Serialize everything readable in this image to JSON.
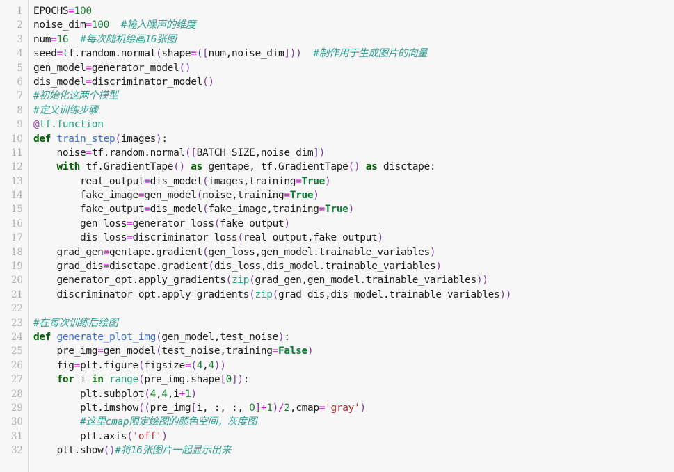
{
  "editor": {
    "background_color": "#f7f7f7",
    "gutter_color": "#f7f7f7",
    "line_number_color": "#b0b0b0",
    "language": "Python",
    "first_line_number": 1,
    "last_line_number": 32,
    "total_lines": 32
  },
  "palette": {
    "keyword": "#006400",
    "constant": "#0a7a33",
    "number": "#1a7f37",
    "operator": "#cc00cc",
    "bracket": "#7a3fa0",
    "comment": "#2e9e8f",
    "function": "#3b6fd4",
    "builtin": "#1f9e7a",
    "decorator": "#a040c0",
    "string": "#b03030",
    "text": "#202020"
  },
  "line_numbers": [
    "1",
    "2",
    "3",
    "4",
    "5",
    "6",
    "7",
    "8",
    "9",
    "10",
    "11",
    "12",
    "13",
    "14",
    "15",
    "16",
    "17",
    "18",
    "19",
    "20",
    "21",
    "22",
    "23",
    "24",
    "25",
    "26",
    "27",
    "28",
    "29",
    "30",
    "31",
    "32"
  ],
  "code_lines": [
    {
      "number": "1",
      "text": "EPOCHS=100",
      "tokens": [
        {
          "t": "EPOCHS",
          "c": "t-plain"
        },
        {
          "t": "=",
          "c": "t-op"
        },
        {
          "t": "100",
          "c": "t-num"
        }
      ]
    },
    {
      "number": "2",
      "text": "noise_dim=100  #输入噪声的维度",
      "tokens": [
        {
          "t": "noise_dim",
          "c": "t-plain"
        },
        {
          "t": "=",
          "c": "t-op"
        },
        {
          "t": "100",
          "c": "t-num"
        },
        {
          "t": "  ",
          "c": "t-plain"
        },
        {
          "t": "#输入噪声的维度",
          "c": "t-comment"
        }
      ]
    },
    {
      "number": "3",
      "text": "num=16  #每次随机绘画16张图",
      "tokens": [
        {
          "t": "num",
          "c": "t-plain"
        },
        {
          "t": "=",
          "c": "t-op"
        },
        {
          "t": "16",
          "c": "t-num"
        },
        {
          "t": "  ",
          "c": "t-plain"
        },
        {
          "t": "#每次随机绘画16张图",
          "c": "t-comment"
        }
      ]
    },
    {
      "number": "4",
      "text": "seed=tf.random.normal(shape=([num,noise_dim]))  #制作用于生成图片的向量",
      "tokens": [
        {
          "t": "seed",
          "c": "t-plain"
        },
        {
          "t": "=",
          "c": "t-op"
        },
        {
          "t": "tf.random.normal",
          "c": "t-plain"
        },
        {
          "t": "(",
          "c": "t-punct"
        },
        {
          "t": "shape",
          "c": "t-plain"
        },
        {
          "t": "=",
          "c": "t-op"
        },
        {
          "t": "([",
          "c": "t-punct"
        },
        {
          "t": "num,noise_dim",
          "c": "t-plain"
        },
        {
          "t": "]))",
          "c": "t-punct"
        },
        {
          "t": "  ",
          "c": "t-plain"
        },
        {
          "t": "#制作用于生成图片的向量",
          "c": "t-comment"
        }
      ]
    },
    {
      "number": "5",
      "text": "gen_model=generator_model()",
      "tokens": [
        {
          "t": "gen_model",
          "c": "t-plain"
        },
        {
          "t": "=",
          "c": "t-op"
        },
        {
          "t": "generator_model",
          "c": "t-plain"
        },
        {
          "t": "()",
          "c": "t-punct"
        }
      ]
    },
    {
      "number": "6",
      "text": "dis_model=discriminator_model()",
      "tokens": [
        {
          "t": "dis_model",
          "c": "t-plain"
        },
        {
          "t": "=",
          "c": "t-op"
        },
        {
          "t": "discriminator_model",
          "c": "t-plain"
        },
        {
          "t": "()",
          "c": "t-punct"
        }
      ]
    },
    {
      "number": "7",
      "text": "#初始化这两个模型",
      "tokens": [
        {
          "t": "#初始化这两个模型",
          "c": "t-comment"
        }
      ]
    },
    {
      "number": "8",
      "text": "#定义训练步骤",
      "tokens": [
        {
          "t": "#定义训练步骤",
          "c": "t-comment"
        }
      ]
    },
    {
      "number": "9",
      "text": "@tf.function",
      "tokens": [
        {
          "t": "@",
          "c": "t-deco"
        },
        {
          "t": "tf.function",
          "c": "t-builtin"
        }
      ]
    },
    {
      "number": "10",
      "text": "def train_step(images):",
      "tokens": [
        {
          "t": "def",
          "c": "t-kw"
        },
        {
          "t": " ",
          "c": "t-plain"
        },
        {
          "t": "train_step",
          "c": "t-func"
        },
        {
          "t": "(",
          "c": "t-punct"
        },
        {
          "t": "images",
          "c": "t-plain"
        },
        {
          "t": ")",
          "c": "t-punct"
        },
        {
          "t": ":",
          "c": "t-plain"
        }
      ]
    },
    {
      "number": "11",
      "text": "    noise=tf.random.normal([BATCH_SIZE,noise_dim])",
      "tokens": [
        {
          "t": "    noise",
          "c": "t-plain"
        },
        {
          "t": "=",
          "c": "t-op"
        },
        {
          "t": "tf.random.normal",
          "c": "t-plain"
        },
        {
          "t": "([",
          "c": "t-punct"
        },
        {
          "t": "BATCH_SIZE,noise_dim",
          "c": "t-plain"
        },
        {
          "t": "])",
          "c": "t-punct"
        }
      ]
    },
    {
      "number": "12",
      "text": "    with tf.GradientTape() as gentape, tf.GradientTape() as disctape:",
      "tokens": [
        {
          "t": "    ",
          "c": "t-plain"
        },
        {
          "t": "with",
          "c": "t-kw"
        },
        {
          "t": " tf.GradientTape",
          "c": "t-plain"
        },
        {
          "t": "()",
          "c": "t-punct"
        },
        {
          "t": " ",
          "c": "t-plain"
        },
        {
          "t": "as",
          "c": "t-kw"
        },
        {
          "t": " gentape, tf.GradientTape",
          "c": "t-plain"
        },
        {
          "t": "()",
          "c": "t-punct"
        },
        {
          "t": " ",
          "c": "t-plain"
        },
        {
          "t": "as",
          "c": "t-kw"
        },
        {
          "t": " disctape:",
          "c": "t-plain"
        }
      ]
    },
    {
      "number": "13",
      "text": "        real_output=dis_model(images,training=True)",
      "tokens": [
        {
          "t": "        real_output",
          "c": "t-plain"
        },
        {
          "t": "=",
          "c": "t-op"
        },
        {
          "t": "dis_model",
          "c": "t-plain"
        },
        {
          "t": "(",
          "c": "t-punct"
        },
        {
          "t": "images,training",
          "c": "t-plain"
        },
        {
          "t": "=",
          "c": "t-op"
        },
        {
          "t": "True",
          "c": "t-const"
        },
        {
          "t": ")",
          "c": "t-punct"
        }
      ]
    },
    {
      "number": "14",
      "text": "        fake_image=gen_model(noise,training=True)",
      "tokens": [
        {
          "t": "        fake_image",
          "c": "t-plain"
        },
        {
          "t": "=",
          "c": "t-op"
        },
        {
          "t": "gen_model",
          "c": "t-plain"
        },
        {
          "t": "(",
          "c": "t-punct"
        },
        {
          "t": "noise,training",
          "c": "t-plain"
        },
        {
          "t": "=",
          "c": "t-op"
        },
        {
          "t": "True",
          "c": "t-const"
        },
        {
          "t": ")",
          "c": "t-punct"
        }
      ]
    },
    {
      "number": "15",
      "text": "        fake_output=dis_model(fake_image,training=True)",
      "tokens": [
        {
          "t": "        fake_output",
          "c": "t-plain"
        },
        {
          "t": "=",
          "c": "t-op"
        },
        {
          "t": "dis_model",
          "c": "t-plain"
        },
        {
          "t": "(",
          "c": "t-punct"
        },
        {
          "t": "fake_image,training",
          "c": "t-plain"
        },
        {
          "t": "=",
          "c": "t-op"
        },
        {
          "t": "True",
          "c": "t-const"
        },
        {
          "t": ")",
          "c": "t-punct"
        }
      ]
    },
    {
      "number": "16",
      "text": "        gen_loss=generator_loss(fake_output)",
      "tokens": [
        {
          "t": "        gen_loss",
          "c": "t-plain"
        },
        {
          "t": "=",
          "c": "t-op"
        },
        {
          "t": "generator_loss",
          "c": "t-plain"
        },
        {
          "t": "(",
          "c": "t-punct"
        },
        {
          "t": "fake_output",
          "c": "t-plain"
        },
        {
          "t": ")",
          "c": "t-punct"
        }
      ]
    },
    {
      "number": "17",
      "text": "        dis_loss=discriminator_loss(real_output,fake_output)",
      "tokens": [
        {
          "t": "        dis_loss",
          "c": "t-plain"
        },
        {
          "t": "=",
          "c": "t-op"
        },
        {
          "t": "discriminator_loss",
          "c": "t-plain"
        },
        {
          "t": "(",
          "c": "t-punct"
        },
        {
          "t": "real_output,fake_output",
          "c": "t-plain"
        },
        {
          "t": ")",
          "c": "t-punct"
        }
      ]
    },
    {
      "number": "18",
      "text": "    grad_gen=gentape.gradient(gen_loss,gen_model.trainable_variables)",
      "tokens": [
        {
          "t": "    grad_gen",
          "c": "t-plain"
        },
        {
          "t": "=",
          "c": "t-op"
        },
        {
          "t": "gentape.gradient",
          "c": "t-plain"
        },
        {
          "t": "(",
          "c": "t-punct"
        },
        {
          "t": "gen_loss,gen_model.trainable_variables",
          "c": "t-plain"
        },
        {
          "t": ")",
          "c": "t-punct"
        }
      ]
    },
    {
      "number": "19",
      "text": "    grad_dis=disctape.gradient(dis_loss,dis_model.trainable_variables)",
      "tokens": [
        {
          "t": "    grad_dis",
          "c": "t-plain"
        },
        {
          "t": "=",
          "c": "t-op"
        },
        {
          "t": "disctape.gradient",
          "c": "t-plain"
        },
        {
          "t": "(",
          "c": "t-punct"
        },
        {
          "t": "dis_loss,dis_model.trainable_variables",
          "c": "t-plain"
        },
        {
          "t": ")",
          "c": "t-punct"
        }
      ]
    },
    {
      "number": "20",
      "text": "    generator_opt.apply_gradients(zip(grad_gen,gen_model.trainable_variables))",
      "tokens": [
        {
          "t": "    generator_opt.apply_gradients",
          "c": "t-plain"
        },
        {
          "t": "(",
          "c": "t-punct"
        },
        {
          "t": "zip",
          "c": "t-builtin"
        },
        {
          "t": "(",
          "c": "t-punct"
        },
        {
          "t": "grad_gen,gen_model.trainable_variables",
          "c": "t-plain"
        },
        {
          "t": "))",
          "c": "t-punct"
        }
      ]
    },
    {
      "number": "21",
      "text": "    discriminator_opt.apply_gradients(zip(grad_dis,dis_model.trainable_variables))",
      "tokens": [
        {
          "t": "    discriminator_opt.apply_gradients",
          "c": "t-plain"
        },
        {
          "t": "(",
          "c": "t-punct"
        },
        {
          "t": "zip",
          "c": "t-builtin"
        },
        {
          "t": "(",
          "c": "t-punct"
        },
        {
          "t": "grad_dis,dis_model.trainable_variables",
          "c": "t-plain"
        },
        {
          "t": "))",
          "c": "t-punct"
        }
      ]
    },
    {
      "number": "22",
      "text": "",
      "tokens": []
    },
    {
      "number": "23",
      "text": "#在每次训练后绘图",
      "tokens": [
        {
          "t": "#在每次训练后绘图",
          "c": "t-comment"
        }
      ]
    },
    {
      "number": "24",
      "text": "def generate_plot_img(gen_model,test_noise):",
      "tokens": [
        {
          "t": "def",
          "c": "t-kw"
        },
        {
          "t": " ",
          "c": "t-plain"
        },
        {
          "t": "generate_plot_img",
          "c": "t-func"
        },
        {
          "t": "(",
          "c": "t-punct"
        },
        {
          "t": "gen_model,test_noise",
          "c": "t-plain"
        },
        {
          "t": ")",
          "c": "t-punct"
        },
        {
          "t": ":",
          "c": "t-plain"
        }
      ]
    },
    {
      "number": "25",
      "text": "    pre_img=gen_model(test_noise,training=False)",
      "tokens": [
        {
          "t": "    pre_img",
          "c": "t-plain"
        },
        {
          "t": "=",
          "c": "t-op"
        },
        {
          "t": "gen_model",
          "c": "t-plain"
        },
        {
          "t": "(",
          "c": "t-punct"
        },
        {
          "t": "test_noise,training",
          "c": "t-plain"
        },
        {
          "t": "=",
          "c": "t-op"
        },
        {
          "t": "False",
          "c": "t-const"
        },
        {
          "t": ")",
          "c": "t-punct"
        }
      ]
    },
    {
      "number": "26",
      "text": "    fig=plt.figure(figsize=(4,4))",
      "tokens": [
        {
          "t": "    fig",
          "c": "t-plain"
        },
        {
          "t": "=",
          "c": "t-op"
        },
        {
          "t": "plt.figure",
          "c": "t-plain"
        },
        {
          "t": "(",
          "c": "t-punct"
        },
        {
          "t": "figsize",
          "c": "t-plain"
        },
        {
          "t": "=",
          "c": "t-op"
        },
        {
          "t": "(",
          "c": "t-punct"
        },
        {
          "t": "4",
          "c": "t-num"
        },
        {
          "t": ",",
          "c": "t-plain"
        },
        {
          "t": "4",
          "c": "t-num"
        },
        {
          "t": "))",
          "c": "t-punct"
        }
      ]
    },
    {
      "number": "27",
      "text": "    for i in range(pre_img.shape[0]):",
      "tokens": [
        {
          "t": "    ",
          "c": "t-plain"
        },
        {
          "t": "for",
          "c": "t-kw"
        },
        {
          "t": " i ",
          "c": "t-plain"
        },
        {
          "t": "in",
          "c": "t-kw"
        },
        {
          "t": " ",
          "c": "t-plain"
        },
        {
          "t": "range",
          "c": "t-builtin"
        },
        {
          "t": "(",
          "c": "t-punct"
        },
        {
          "t": "pre_img.shape",
          "c": "t-plain"
        },
        {
          "t": "[",
          "c": "t-punct"
        },
        {
          "t": "0",
          "c": "t-num"
        },
        {
          "t": "])",
          "c": "t-punct"
        },
        {
          "t": ":",
          "c": "t-plain"
        }
      ]
    },
    {
      "number": "28",
      "text": "        plt.subplot(4,4,i+1)",
      "tokens": [
        {
          "t": "        plt.subplot",
          "c": "t-plain"
        },
        {
          "t": "(",
          "c": "t-punct"
        },
        {
          "t": "4",
          "c": "t-num"
        },
        {
          "t": ",",
          "c": "t-plain"
        },
        {
          "t": "4",
          "c": "t-num"
        },
        {
          "t": ",i",
          "c": "t-plain"
        },
        {
          "t": "+",
          "c": "t-op"
        },
        {
          "t": "1",
          "c": "t-num"
        },
        {
          "t": ")",
          "c": "t-punct"
        }
      ]
    },
    {
      "number": "29",
      "text": "        plt.imshow((pre_img[i, :, :, 0]+1)/2,cmap='gray')",
      "tokens": [
        {
          "t": "        plt.imshow",
          "c": "t-plain"
        },
        {
          "t": "((",
          "c": "t-punct"
        },
        {
          "t": "pre_img",
          "c": "t-plain"
        },
        {
          "t": "[",
          "c": "t-punct"
        },
        {
          "t": "i, :, :, ",
          "c": "t-plain"
        },
        {
          "t": "0",
          "c": "t-num"
        },
        {
          "t": "]",
          "c": "t-punct"
        },
        {
          "t": "+",
          "c": "t-op"
        },
        {
          "t": "1",
          "c": "t-num"
        },
        {
          "t": ")",
          "c": "t-punct"
        },
        {
          "t": "/",
          "c": "t-op"
        },
        {
          "t": "2",
          "c": "t-num"
        },
        {
          "t": ",cmap",
          "c": "t-plain"
        },
        {
          "t": "=",
          "c": "t-op"
        },
        {
          "t": "'gray'",
          "c": "t-str"
        },
        {
          "t": ")",
          "c": "t-punct"
        }
      ]
    },
    {
      "number": "30",
      "text": "        #这里cmap限定绘图的颜色空间，灰度图",
      "tokens": [
        {
          "t": "        ",
          "c": "t-plain"
        },
        {
          "t": "#这里cmap限定绘图的颜色空间，灰度图",
          "c": "t-comment"
        }
      ]
    },
    {
      "number": "31",
      "text": "        plt.axis('off')",
      "tokens": [
        {
          "t": "        plt.axis",
          "c": "t-plain"
        },
        {
          "t": "(",
          "c": "t-punct"
        },
        {
          "t": "'off'",
          "c": "t-str"
        },
        {
          "t": ")",
          "c": "t-punct"
        }
      ]
    },
    {
      "number": "32",
      "text": "    plt.show()#将16张图片一起显示出来",
      "tokens": [
        {
          "t": "    plt.show",
          "c": "t-plain"
        },
        {
          "t": "()",
          "c": "t-punct"
        },
        {
          "t": "#将16张图片一起显示出来",
          "c": "t-comment"
        }
      ]
    }
  ]
}
